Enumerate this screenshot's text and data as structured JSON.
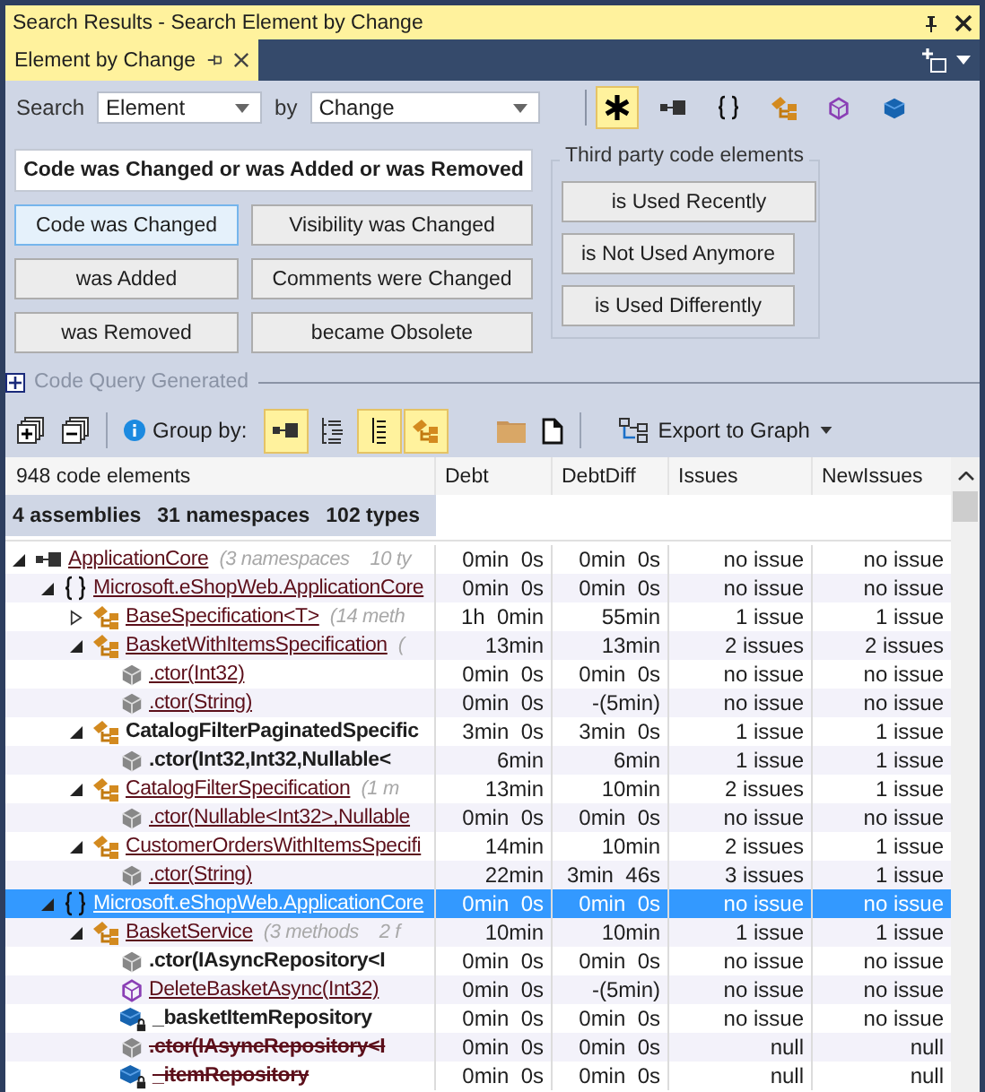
{
  "window": {
    "title": "Search Results - Search Element by Change"
  },
  "tab": {
    "label": "Element by Change",
    "selected": true
  },
  "search": {
    "label": "Search",
    "element": "Element",
    "by_label": "by",
    "by": "Change",
    "filters": [
      {
        "kind": "all",
        "selected": true
      },
      {
        "kind": "assembly",
        "selected": false
      },
      {
        "kind": "namespace",
        "selected": false
      },
      {
        "kind": "type",
        "selected": false
      },
      {
        "kind": "interface",
        "selected": false
      },
      {
        "kind": "field",
        "selected": false
      }
    ]
  },
  "main_query": "Code was Changed or was Added or was Removed",
  "change_buttons": [
    {
      "label": "Code was Changed",
      "selected": true
    },
    {
      "label": "Visibility was Changed",
      "selected": false
    },
    {
      "label": "was Added",
      "selected": false
    },
    {
      "label": "Comments were Changed",
      "selected": false
    },
    {
      "label": "was Removed",
      "selected": false
    },
    {
      "label": "became Obsolete",
      "selected": false
    }
  ],
  "third_party": {
    "title": "Third party code elements",
    "buttons": [
      "is Used Recently",
      "is Not Used Anymore",
      "is Used Differently"
    ]
  },
  "code_query": {
    "label": "Code Query Generated",
    "expanded": false
  },
  "toolbar": {
    "group_by_label": "Group by:",
    "group_by": [
      {
        "kind": "assembly",
        "selected": true
      },
      {
        "kind": "tree",
        "selected": false
      },
      {
        "kind": "list",
        "selected": true
      },
      {
        "kind": "type",
        "selected": true
      }
    ],
    "export": "Export to Graph"
  },
  "table": {
    "first_column": "948 code elements",
    "columns": [
      "Debt",
      "DebtDiff",
      "Issues",
      "NewIssues"
    ],
    "summary": [
      "4 assemblies",
      "31 namespaces",
      "102 types"
    ],
    "rows": [
      {
        "kind": "assembly",
        "name": "ApplicationCore",
        "note": "(3 namespaces    10 ty",
        "changed": true,
        "added": false,
        "removed": false,
        "expanded": true,
        "selected": false,
        "values": [
          "0min  0s",
          "0min  0s",
          "no issue",
          "no issue"
        ],
        "children": [
          {
            "kind": "namespace",
            "name": "Microsoft.eShopWeb.ApplicationCore",
            "changed": true,
            "added": false,
            "removed": false,
            "expanded": true,
            "selected": false,
            "values": [
              "0min  0s",
              "0min  0s",
              "no issue",
              "no issue"
            ],
            "children": [
              {
                "kind": "type",
                "name": "BaseSpecification<T>",
                "note": "(14 meth",
                "changed": true,
                "added": false,
                "removed": false,
                "expanded": false,
                "selected": false,
                "values": [
                  "1h  0min",
                  "55min",
                  "1 issue",
                  "1 issue"
                ]
              },
              {
                "kind": "type",
                "name": "BasketWithItemsSpecification",
                "note": "(",
                "changed": true,
                "added": false,
                "removed": false,
                "expanded": true,
                "selected": false,
                "values": [
                  "13min",
                  "13min",
                  "2 issues",
                  "2 issues"
                ],
                "children": [
                  {
                    "kind": "method",
                    "name": ".ctor(Int32)",
                    "changed": true,
                    "added": false,
                    "removed": false,
                    "selected": false,
                    "values": [
                      "0min  0s",
                      "0min  0s",
                      "no issue",
                      "no issue"
                    ]
                  },
                  {
                    "kind": "method",
                    "name": ".ctor(String)",
                    "changed": true,
                    "added": false,
                    "removed": false,
                    "selected": false,
                    "values": [
                      "0min  0s",
                      "-(5min)",
                      "no issue",
                      "no issue"
                    ]
                  }
                ]
              },
              {
                "kind": "type",
                "name": "CatalogFilterPaginatedSpecific",
                "changed": false,
                "added": true,
                "removed": false,
                "expanded": true,
                "selected": false,
                "values": [
                  "3min  0s",
                  "3min  0s",
                  "1 issue",
                  "1 issue"
                ],
                "children": [
                  {
                    "kind": "method",
                    "name": ".ctor(Int32,Int32,Nullable<",
                    "changed": false,
                    "added": true,
                    "removed": false,
                    "selected": false,
                    "values": [
                      "6min",
                      "6min",
                      "1 issue",
                      "1 issue"
                    ]
                  }
                ]
              },
              {
                "kind": "type",
                "name": "CatalogFilterSpecification",
                "note": "(1 m",
                "changed": true,
                "added": false,
                "removed": false,
                "expanded": true,
                "selected": false,
                "values": [
                  "13min",
                  "10min",
                  "2 issues",
                  "1 issue"
                ],
                "children": [
                  {
                    "kind": "method",
                    "name": ".ctor(Nullable<Int32>,Nullable",
                    "changed": true,
                    "added": false,
                    "removed": false,
                    "selected": false,
                    "values": [
                      "0min  0s",
                      "0min  0s",
                      "no issue",
                      "no issue"
                    ]
                  }
                ]
              },
              {
                "kind": "type",
                "name": "CustomerOrdersWithItemsSpecifi",
                "changed": true,
                "added": false,
                "removed": false,
                "expanded": true,
                "selected": false,
                "values": [
                  "14min",
                  "10min",
                  "2 issues",
                  "1 issue"
                ],
                "children": [
                  {
                    "kind": "method",
                    "name": ".ctor(String)",
                    "changed": true,
                    "added": false,
                    "removed": false,
                    "selected": false,
                    "values": [
                      "22min",
                      "3min  46s",
                      "3 issues",
                      "1 issue"
                    ]
                  }
                ]
              }
            ]
          },
          {
            "kind": "namespace",
            "name": "Microsoft.eShopWeb.ApplicationCore",
            "changed": true,
            "added": false,
            "removed": false,
            "expanded": true,
            "selected": true,
            "values": [
              "0min  0s",
              "0min  0s",
              "no issue",
              "no issue"
            ],
            "children": [
              {
                "kind": "type",
                "name": "BasketService",
                "note": "(3 methods    2 f",
                "changed": true,
                "added": false,
                "removed": false,
                "expanded": true,
                "selected": false,
                "values": [
                  "10min",
                  "10min",
                  "1 issue",
                  "1 issue"
                ],
                "children": [
                  {
                    "kind": "method",
                    "name": ".ctor(IAsyncRepository<I",
                    "changed": false,
                    "added": true,
                    "removed": false,
                    "selected": false,
                    "values": [
                      "0min  0s",
                      "0min  0s",
                      "no issue",
                      "no issue"
                    ]
                  },
                  {
                    "kind": "interface",
                    "name": "DeleteBasketAsync(Int32)",
                    "changed": true,
                    "added": false,
                    "removed": false,
                    "selected": false,
                    "values": [
                      "0min  0s",
                      "-(5min)",
                      "no issue",
                      "no issue"
                    ]
                  },
                  {
                    "kind": "field",
                    "name": "_basketItemRepository",
                    "changed": false,
                    "added": true,
                    "removed": false,
                    "selected": false,
                    "values": [
                      "0min  0s",
                      "0min  0s",
                      "no issue",
                      "no issue"
                    ]
                  },
                  {
                    "kind": "method",
                    "name": ".ctor(IAsyncRepository<I",
                    "changed": false,
                    "added": false,
                    "removed": true,
                    "selected": false,
                    "values": [
                      "0min  0s",
                      "0min  0s",
                      "null",
                      "null"
                    ]
                  },
                  {
                    "kind": "field",
                    "name": "_itemRepository",
                    "changed": false,
                    "added": false,
                    "removed": true,
                    "selected": false,
                    "values": [
                      "0min  0s",
                      "0min  0s",
                      "null",
                      "null"
                    ]
                  }
                ]
              }
            ]
          }
        ]
      }
    ]
  }
}
